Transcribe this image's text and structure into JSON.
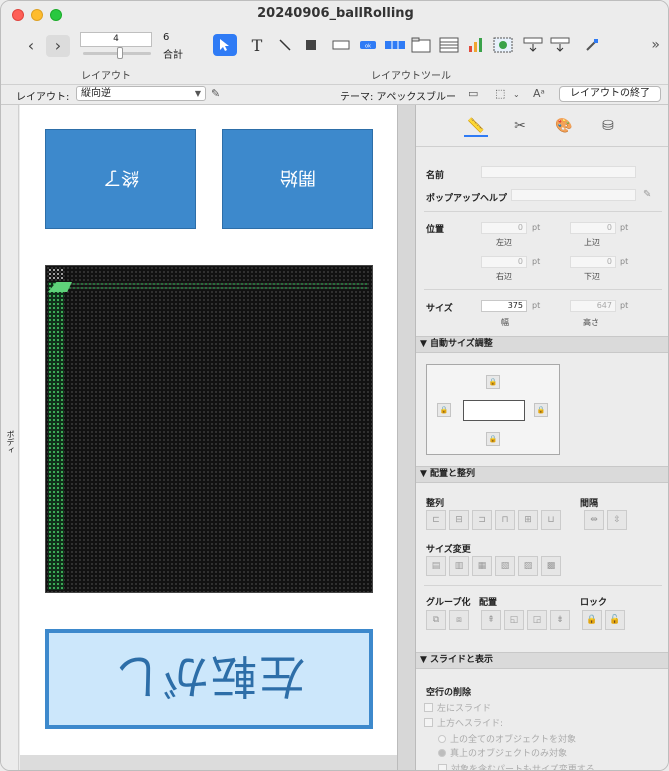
{
  "window": {
    "title": "20240906_ballRolling"
  },
  "toolbar": {
    "layout_number": "4",
    "total_number": "6",
    "total_label": "合計",
    "layout_caption": "レイアウト",
    "tools_caption": "レイアウトツール"
  },
  "layout_bar": {
    "label": "レイアウト:",
    "selected_layout": "縦向逆",
    "theme": "テーマ: アペックスブルー",
    "exit_label": "レイアウトの終了"
  },
  "ruler": {
    "part_label": "ボディ"
  },
  "canvas": {
    "button_left": "終了",
    "button_right": "開始",
    "rotate_button": "左転がし"
  },
  "inspector": {
    "name_label": "名前",
    "name_value": "",
    "popup_help_label": "ポップアップヘルプ",
    "popup_help_value": "",
    "position_label": "位置",
    "left_value": "0",
    "left_label": "左辺",
    "top_value": "0",
    "top_label": "上辺",
    "right_value": "0",
    "right_label": "右辺",
    "bottom_value": "0",
    "bottom_label": "下辺",
    "size_label": "サイズ",
    "width_value": "375",
    "width_label": "幅",
    "height_value": "647",
    "height_label": "高さ",
    "unit": "pt",
    "section_autosize": "▼ 自動サイズ調整",
    "section_arrange": "▼ 配置と整列",
    "align_label": "整列",
    "spacing_label": "間隔",
    "resize_label": "サイズ変更",
    "group_label": "グループ化",
    "arrange_label": "配置",
    "lock_label": "ロック",
    "section_slide": "▼ スライドと表示",
    "remove_blank_label": "空行の削除",
    "slide_left": "左にスライド",
    "slide_up": "上方へスライド:",
    "radio_all_above": "上の全てのオブジェクトを対象",
    "radio_directly_above": "真上のオブジェクトのみ対象",
    "resize_part": "対象を含むパートもサイズ変更する"
  }
}
